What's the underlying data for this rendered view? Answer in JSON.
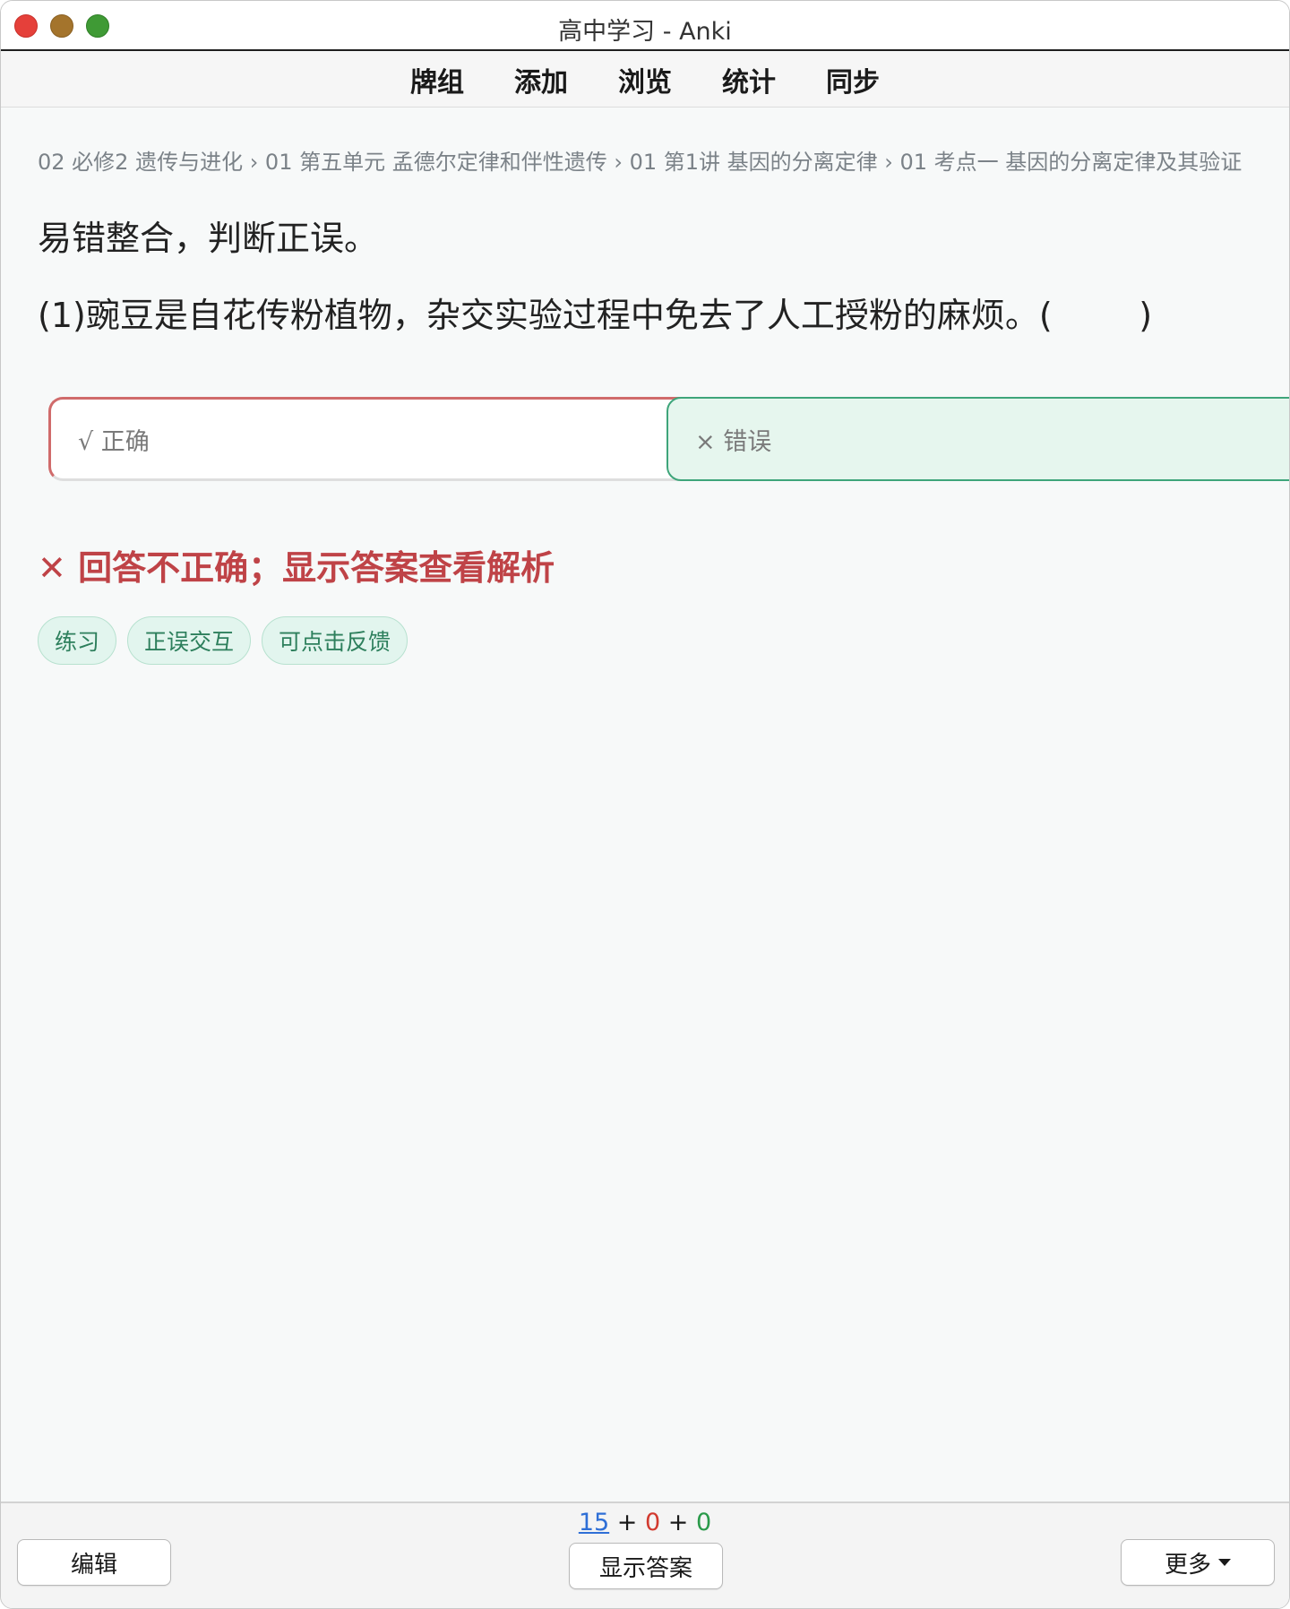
{
  "window": {
    "title": "高中学习 - Anki"
  },
  "toolbar": {
    "items": [
      "牌组",
      "添加",
      "浏览",
      "统计",
      "同步"
    ]
  },
  "card": {
    "breadcrumb": "02 必修2 遗传与进化 › 01 第五单元 孟德尔定律和伴性遗传 › 01 第1讲 基因的分离定律 › 01 考点一 基因的分离定律及其验证",
    "heading": "易错整合，判断正误。",
    "question": "(1)豌豆是自花传粉植物，杂交实验过程中免去了人工授粉的麻烦。(        )",
    "options": {
      "true_label": "√ 正确",
      "false_label": "× 错误"
    },
    "feedback": "✕ 回答不正确；显示答案查看解析",
    "tags": [
      "练习",
      "正误交互",
      "可点击反馈"
    ]
  },
  "bottom": {
    "counts": {
      "new": "15",
      "learn": "0",
      "review": "0",
      "sep": "+"
    },
    "edit_label": "编辑",
    "show_answer_label": "显示答案",
    "more_label": "更多"
  },
  "colors": {
    "wrong_red": "#bf4347",
    "correct_green": "#3ea57a",
    "new_blue": "#2f6fd6",
    "learn_red": "#d23a2f",
    "review_green": "#2a9a4a"
  },
  "icons": {
    "dropdown": "chevron-down-icon",
    "close_window": "close-icon",
    "minimize_window": "minimize-icon",
    "zoom_window": "zoom-icon"
  }
}
